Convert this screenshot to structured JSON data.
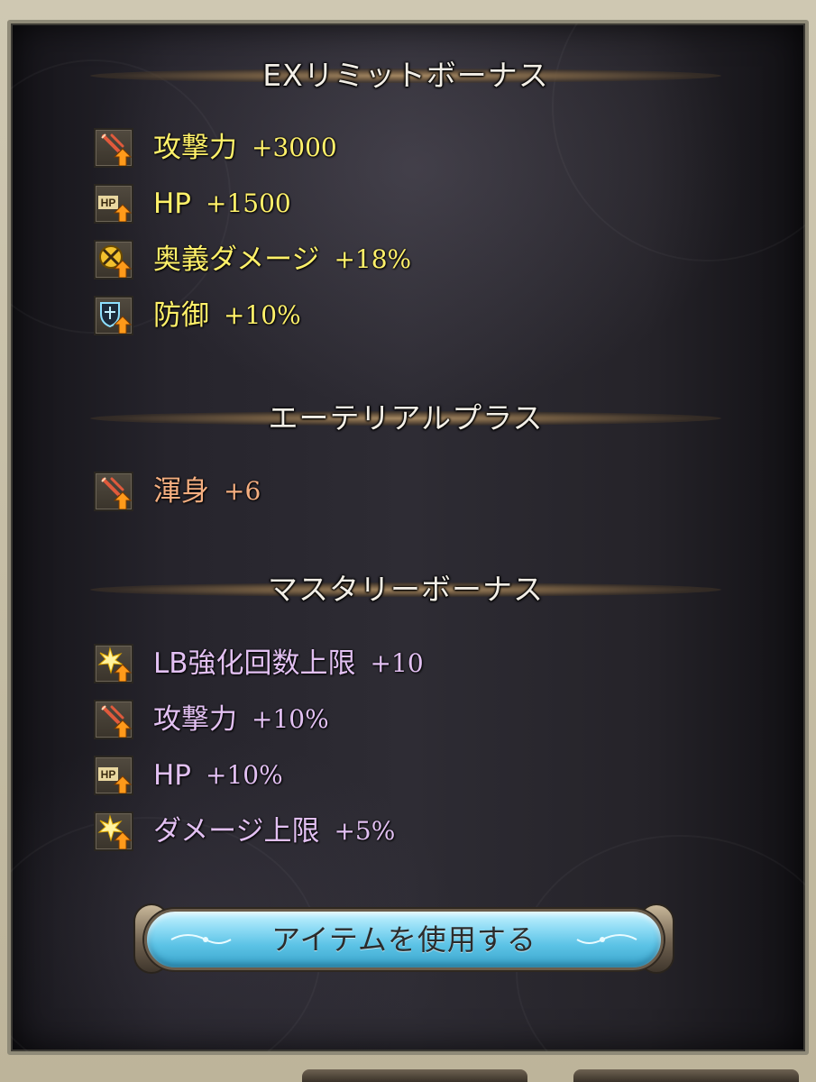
{
  "sections": [
    {
      "title": "EXリミットボーナス",
      "items": [
        {
          "label": "攻撃力",
          "value": "+3000",
          "icon": "attack-sword-icon"
        },
        {
          "label": "HP",
          "value": "+1500",
          "icon": "hp-icon"
        },
        {
          "label": "奥義ダメージ",
          "value": "+18%",
          "icon": "ougi-damage-icon"
        },
        {
          "label": "防御",
          "value": "+10%",
          "icon": "defense-shield-icon"
        }
      ]
    },
    {
      "title": "エーテリアルプラス",
      "items": [
        {
          "label": "渾身",
          "value": "+6",
          "icon": "attack-sword-icon"
        }
      ]
    },
    {
      "title": "マスタリーボーナス",
      "items": [
        {
          "label": "LB強化回数上限",
          "value": "+10",
          "icon": "star-burst-icon"
        },
        {
          "label": "攻撃力",
          "value": "+10%",
          "icon": "attack-sword-icon"
        },
        {
          "label": "HP",
          "value": "+10%",
          "icon": "hp-icon"
        },
        {
          "label": "ダメージ上限",
          "value": "+5%",
          "icon": "star-burst-icon"
        }
      ]
    }
  ],
  "use_item_button": {
    "label": "アイテムを使用する"
  },
  "colors": {
    "ex_limit_text": "#fff16a",
    "etherial_text": "#f4ae80",
    "mastery_text": "#e2c0f2",
    "button_blue": "#5cc3e6"
  }
}
